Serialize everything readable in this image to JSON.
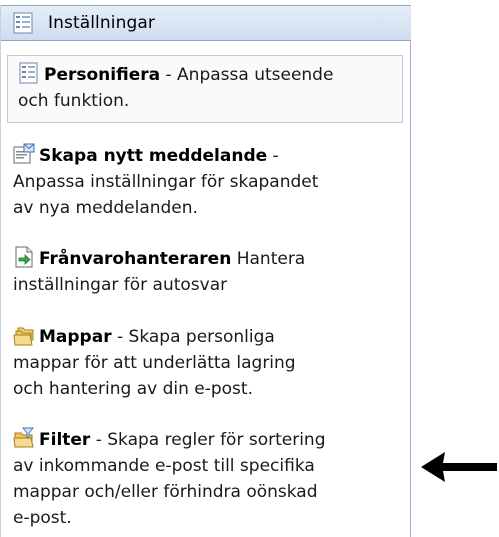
{
  "header": {
    "title": "Inställningar",
    "icon": "settings-list-icon"
  },
  "items": [
    {
      "title": "Personifiera",
      "separator": " - ",
      "line1_rest": "Anpassa utseende",
      "line2": "och funktion.",
      "line3": "",
      "line4": "",
      "icon": "settings-list-icon",
      "selected": true
    },
    {
      "title": "Skapa nytt meddelande",
      "separator": " -",
      "line1_rest": "",
      "line2": "Anpassa inställningar för skapandet",
      "line3": "av nya meddelanden.",
      "line4": "",
      "icon": "new-message-icon"
    },
    {
      "title": "Frånvarohanteraren",
      "separator": " ",
      "line1_rest": "Hantera",
      "line2": "inställningar för autosvar",
      "line3": "",
      "line4": "",
      "icon": "auto-reply-icon"
    },
    {
      "title": "Mappar",
      "separator": " - ",
      "line1_rest": "Skapa personliga",
      "line2": "mappar för att underlätta lagring",
      "line3": "och hantering av din e-post.",
      "line4": "",
      "icon": "folders-icon"
    },
    {
      "title": "Filter",
      "separator": " - ",
      "line1_rest": "Skapa regler för sortering",
      "line2": "av inkommande e-post till specifika",
      "line3": "mappar och/eller förhindra oönskad",
      "line4": "e-post.",
      "icon": "filter-folder-icon"
    }
  ],
  "annotation": {
    "icon": "left-arrow-icon",
    "color": "#000000"
  },
  "colors": {
    "header_bg": "#d6e2f1",
    "panel_border": "#9fb4d2",
    "selected_border": "#c9c9c9"
  }
}
